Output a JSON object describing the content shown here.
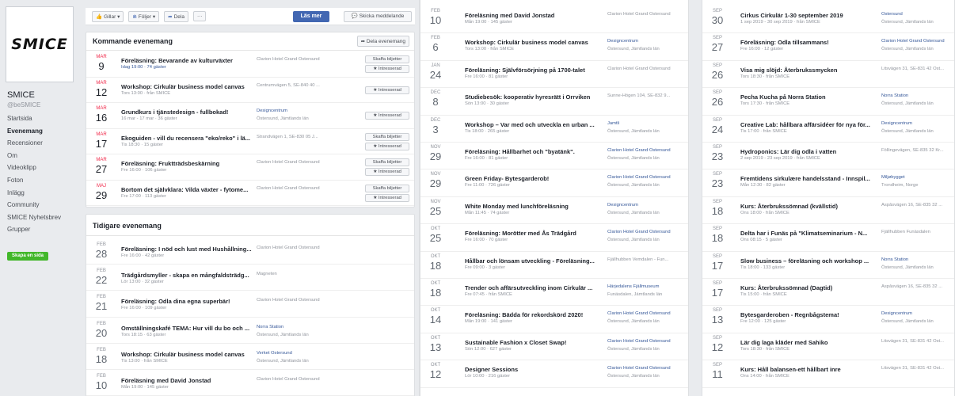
{
  "page": {
    "logo_text": "SMICE",
    "name": "SMICE",
    "handle": "@beSMICE",
    "create_page_label": "Skapa en sida"
  },
  "nav": [
    {
      "label": "Startsida",
      "active": false
    },
    {
      "label": "Evenemang",
      "active": true
    },
    {
      "label": "Recensioner",
      "active": false
    },
    {
      "label": "Om",
      "active": false
    },
    {
      "label": "Videoklipp",
      "active": false
    },
    {
      "label": "Foton",
      "active": false
    },
    {
      "label": "Inlägg",
      "active": false
    },
    {
      "label": "Community",
      "active": false
    },
    {
      "label": "SMICE Nyhetsbrev",
      "active": false
    },
    {
      "label": "Grupper",
      "active": false
    }
  ],
  "actions": {
    "like": "Gillar ▾",
    "follow": "Följer ▾",
    "share": "Dela",
    "more": "···",
    "read_more": "Läs mer",
    "send_message": "Skicka meddelande"
  },
  "upcoming": {
    "title": "Kommande evenemang",
    "share_event": "Dela evenemang",
    "events": [
      {
        "month": "MAR",
        "day": "9",
        "title": "Föreläsning: Bevarande av kulturväxter",
        "sub": "Idag 19:00 · 74 gäster",
        "sub_blue": true,
        "loc": "Clarion Hotel Grand Östersund",
        "loc2": "",
        "loc_blue": false,
        "btn1": "Skaffa biljetter",
        "btn2": "★ Intresserad"
      },
      {
        "month": "MAR",
        "day": "12",
        "title": "Workshop: Cirkulär business model canvas",
        "sub": "Tors 13:00 · från SMICE",
        "sub_blue": false,
        "loc": "Centrumvägen 5, SE-840 40 ...",
        "loc2": "",
        "loc_blue": false,
        "btn1": "",
        "btn2": "★ Intresserad"
      },
      {
        "month": "MAR",
        "day": "16",
        "title": "Grundkurs i tjänstedesign - fullbokad!",
        "sub": "16 mar - 17 mar · 36 gäster",
        "sub_blue": false,
        "loc": "Designcentrum",
        "loc2": "Östersund, Jämtlands län",
        "loc_blue": true,
        "btn1": "",
        "btn2": "★ Intresserad"
      },
      {
        "month": "MAR",
        "day": "17",
        "title": "Ekoguiden - vill du recensera \"eko/reko\" i lä...",
        "sub": "Tis 18:30 · 15 gäster",
        "sub_blue": false,
        "loc": "Strandvägen 1, SE-830 05 J...",
        "loc2": "",
        "loc_blue": false,
        "btn1": "Skaffa biljetter",
        "btn2": "★ Intresserad"
      },
      {
        "month": "MAR",
        "day": "27",
        "title": "Föreläsning: Fruktträdsbeskärning",
        "sub": "Fre 16:00 · 106 gäster",
        "sub_blue": false,
        "loc": "Clarion Hotel Grand Östersund",
        "loc2": "",
        "loc_blue": false,
        "btn1": "Skaffa biljetter",
        "btn2": "★ Intresserad"
      },
      {
        "month": "MAJ",
        "day": "29",
        "title": "Bortom det självklara: Vilda växter - fytome...",
        "sub": "Fre 17:00 · 113 gäster",
        "sub_blue": false,
        "loc": "Clarion Hotel Grand Östersund",
        "loc2": "",
        "loc_blue": false,
        "btn1": "Skaffa biljetter",
        "btn2": "★ Intresserad"
      }
    ]
  },
  "past": {
    "title": "Tidigare evenemang",
    "events": [
      {
        "month": "FEB",
        "day": "28",
        "title": "Föreläsning: I nöd och lust med Hushållning...",
        "sub": "Fre 16:00 · 42 gäster",
        "loc": "Clarion Hotel Grand Östersund",
        "loc2": "",
        "loc_blue": false
      },
      {
        "month": "FEB",
        "day": "22",
        "title": "Trädgårdsmyller - skapa en mångfaldsträdg...",
        "sub": "Lör 13:00 · 32 gäster",
        "loc": "Magneten",
        "loc2": "",
        "loc_blue": false
      },
      {
        "month": "FEB",
        "day": "21",
        "title": "Föreläsning: Odla dina egna superbär!",
        "sub": "Fre 16:00 · 109 gäster",
        "loc": "Clarion Hotel Grand Östersund",
        "loc2": "",
        "loc_blue": false
      },
      {
        "month": "FEB",
        "day": "20",
        "title": "Omställningskafé TEMA: Hur vill du bo och ...",
        "sub": "Tors 18:15 · 63 gäster",
        "loc": "Norra Station",
        "loc2": "Östersund, Jämtlands län",
        "loc_blue": true
      },
      {
        "month": "FEB",
        "day": "18",
        "title": "Workshop: Cirkulär business model canvas",
        "sub": "Tis 13:00 · från SMICE",
        "loc": "Verket Östersund",
        "loc2": "Östersund, Jämtlands län",
        "loc_blue": true
      },
      {
        "month": "FEB",
        "day": "10",
        "title": "Föreläsning med David Jonstad",
        "sub": "Mån 19:00 · 145 gäster",
        "loc": "Clarion Hotel Grand Östersund",
        "loc2": "",
        "loc_blue": false
      }
    ]
  },
  "list2": [
    {
      "month": "FEB",
      "day": "10",
      "title": "Föreläsning med David Jonstad",
      "sub": "Mån 19:00 · 145 gäster",
      "loc": "Clarion Hotel Grand Östersund",
      "loc2": "",
      "loc_blue": false
    },
    {
      "month": "FEB",
      "day": "6",
      "title": "Workshop: Cirkulär business model canvas",
      "sub": "Tors 13:00 · från SMICE",
      "loc": "Designcentrum",
      "loc2": "Östersund, Jämtlands län",
      "loc_blue": true
    },
    {
      "month": "JAN",
      "day": "24",
      "title": "Föreläsning: Självförsörjning på 1700-talet",
      "sub": "Fre 16:00 · 81 gäster",
      "loc": "Clarion Hotel Grand Östersund",
      "loc2": "",
      "loc_blue": false
    },
    {
      "month": "DEC",
      "day": "8",
      "title": "Studiebesök: kooperativ hyresrätt i Orrviken",
      "sub": "Sön 13:00 · 30 gäster",
      "loc": "Sunne-Högen 104, SE-832 9...",
      "loc2": "",
      "loc_blue": false
    },
    {
      "month": "DEC",
      "day": "3",
      "title": "Workshop – Var med och utveckla en urban ...",
      "sub": "Tis 18:00 · 265 gäster",
      "loc": "Jamtli",
      "loc2": "Östersund, Jämtlands län",
      "loc_blue": true
    },
    {
      "month": "NOV",
      "day": "29",
      "title": "Föreläsning: Hållbarhet och \"byatänk\".",
      "sub": "Fre 16:00 · 81 gäster",
      "loc": "Clarion Hotel Grand Östersund",
      "loc2": "Östersund, Jämtlands län",
      "loc_blue": true
    },
    {
      "month": "NOV",
      "day": "29",
      "title": "Green Friday- Bytesgarderob!",
      "sub": "Fre 11:00 · 726 gäster",
      "loc": "Clarion Hotel Grand Östersund",
      "loc2": "Östersund, Jämtlands län",
      "loc_blue": true
    },
    {
      "month": "NOV",
      "day": "25",
      "title": "White Monday med lunchföreläsning",
      "sub": "Mån 11:45 · 74 gäster",
      "loc": "Designcentrum",
      "loc2": "Östersund, Jämtlands län",
      "loc_blue": true
    },
    {
      "month": "OKT",
      "day": "25",
      "title": "Föreläsning: Morötter med Ås Trädgård",
      "sub": "Fre 16:00 · 70 gäster",
      "loc": "Clarion Hotel Grand Östersund",
      "loc2": "Östersund, Jämtlands län",
      "loc_blue": true
    },
    {
      "month": "OKT",
      "day": "18",
      "title": "Hållbar och lönsam utveckling - Föreläsning...",
      "sub": "Fre 09:00 · 3 gäster",
      "loc": "Fjällhubben Vemdalen - Fun...",
      "loc2": "",
      "loc_blue": false
    },
    {
      "month": "OKT",
      "day": "18",
      "title": "Trender och affärsutveckling inom Cirkulär ...",
      "sub": "Fre 07:45 · från SMICE",
      "loc": "Härjedalens Fjällmuseum",
      "loc2": "Funäsdalen, Jämtlands län",
      "loc_blue": true
    },
    {
      "month": "OKT",
      "day": "14",
      "title": "Föreläsning: Bädda för rekordskörd 2020!",
      "sub": "Mån 19:00 · 141 gäster",
      "loc": "Clarion Hotel Grand Östersund",
      "loc2": "Östersund, Jämtlands län",
      "loc_blue": true
    },
    {
      "month": "OKT",
      "day": "13",
      "title": "Sustainable Fashion x Closet Swap!",
      "sub": "Sön 12:00 · 627 gäster",
      "loc": "Clarion Hotel Grand Östersund",
      "loc2": "Östersund, Jämtlands län",
      "loc_blue": true
    },
    {
      "month": "OKT",
      "day": "12",
      "title": "Designer Sessions",
      "sub": "Lör 10:00 · 216 gäster",
      "loc": "Clarion Hotel Grand Östersund",
      "loc2": "Östersund, Jämtlands län",
      "loc_blue": true
    }
  ],
  "list3": [
    {
      "month": "SEP",
      "day": "30",
      "title": "Cirkus Cirkulär 1-30 september 2019",
      "sub": "1 sep 2019 - 30 sep 2019 · från SMICE",
      "loc": "Östersund",
      "loc2": "Östersund, Jämtlands län",
      "loc_blue": true
    },
    {
      "month": "SEP",
      "day": "27",
      "title": "Föreläsning: Odla tillsammans!",
      "sub": "Fre 16:00 · 12 gäster",
      "loc": "Clarion Hotel Grand Östersund",
      "loc2": "Östersund, Jämtlands län",
      "loc_blue": true
    },
    {
      "month": "SEP",
      "day": "26",
      "title": "Visa mig slöjd: Återbrukssmycken",
      "sub": "Tors 18:30 · från SMICE",
      "loc": "Litsvägen 31, SE-831 42 Öst...",
      "loc2": "",
      "loc_blue": false
    },
    {
      "month": "SEP",
      "day": "26",
      "title": "Pecha Kucha på Norra Station",
      "sub": "Tors 17:30 · från SMICE",
      "loc": "Norra Station",
      "loc2": "Östersund, Jämtlands län",
      "loc_blue": true
    },
    {
      "month": "SEP",
      "day": "24",
      "title": "Creative Lab: hållbara affärsidéer för nya för...",
      "sub": "Tis 17:00 · från SMICE",
      "loc": "Designcentrum",
      "loc2": "Östersund, Jämtlands län",
      "loc_blue": true
    },
    {
      "month": "SEP",
      "day": "23",
      "title": "Hydroponics: Lär dig odla i vatten",
      "sub": "2 sep 2019 - 23 sep 2019 · från SMICE",
      "loc": "Föllingevägen, SE-835 32 Kr...",
      "loc2": "",
      "loc_blue": false
    },
    {
      "month": "SEP",
      "day": "23",
      "title": "Fremtidens sirkulære handelsstand - Innspil...",
      "sub": "Mån 12:30 · 82 gäster",
      "loc": "Miljøbygget",
      "loc2": "Trondheim, Norge",
      "loc_blue": true
    },
    {
      "month": "SEP",
      "day": "18",
      "title": "Kurs: Återbrukssömnad (kvällstid)",
      "sub": "Ons 18:00 · från SMICE",
      "loc": "Aspåsvägen 16, SE-835 32 ...",
      "loc2": "",
      "loc_blue": false
    },
    {
      "month": "SEP",
      "day": "18",
      "title": "Delta har i Funäs på \"Klimatseminarium - N...",
      "sub": "Ons 08:15 · 5 gäster",
      "loc": "Fjällhubben Funäsdalen",
      "loc2": "",
      "loc_blue": false
    },
    {
      "month": "SEP",
      "day": "17",
      "title": "Slow business – föreläsning och workshop ...",
      "sub": "Tis 18:00 · 133 gäster",
      "loc": "Norra Station",
      "loc2": "Östersund, Jämtlands län",
      "loc_blue": true
    },
    {
      "month": "SEP",
      "day": "17",
      "title": "Kurs: Återbrukssömnad (Dagtid)",
      "sub": "Tis 15:00 · från SMICE",
      "loc": "Aspåsvägen 16, SE-835 32 ...",
      "loc2": "",
      "loc_blue": false
    },
    {
      "month": "SEP",
      "day": "13",
      "title": "Bytesgarderoben - Regnbågstema!",
      "sub": "Fre 12:00 · 125 gäster",
      "loc": "Designcentrum",
      "loc2": "Östersund, Jämtlands län",
      "loc_blue": true
    },
    {
      "month": "SEP",
      "day": "12",
      "title": "Lär dig laga kläder med Sahiko",
      "sub": "Tors 18:30 · från SMICE",
      "loc": "Litsvägen 31, SE-831 42 Öst...",
      "loc2": "",
      "loc_blue": false
    },
    {
      "month": "SEP",
      "day": "11",
      "title": "Kurs: Håll balansen-ett hållbart inre",
      "sub": "Ons 14:00 · från SMICE",
      "loc": "Litsvägen 31, SE-831 42 Öst...",
      "loc2": "",
      "loc_blue": false
    }
  ]
}
